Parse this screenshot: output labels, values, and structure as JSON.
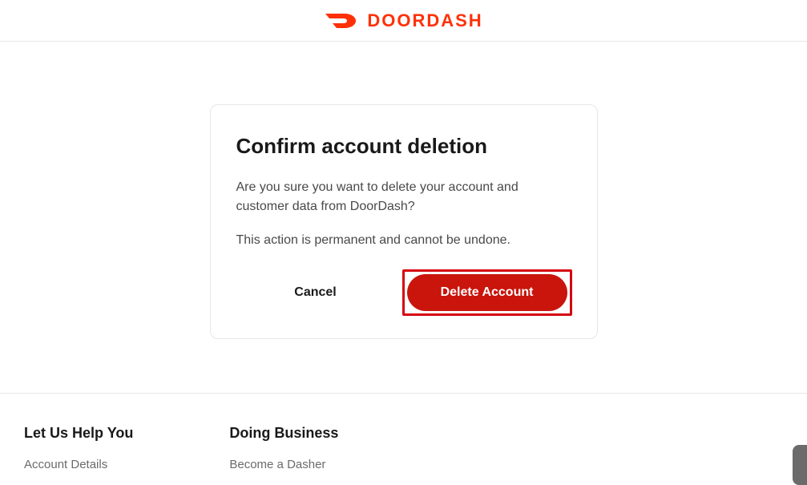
{
  "header": {
    "brand_text": "DOORDASH",
    "brand_color": "#ff3008"
  },
  "dialog": {
    "title": "Confirm account deletion",
    "message_line1": "Are you sure you want to delete your account and customer data from DoorDash?",
    "message_line2": "This action is permanent and cannot be undone.",
    "cancel_label": "Cancel",
    "delete_label": "Delete Account"
  },
  "footer": {
    "col1": {
      "heading": "Let Us Help You",
      "link1": "Account Details"
    },
    "col2": {
      "heading": "Doing Business",
      "link1": "Become a Dasher"
    }
  }
}
